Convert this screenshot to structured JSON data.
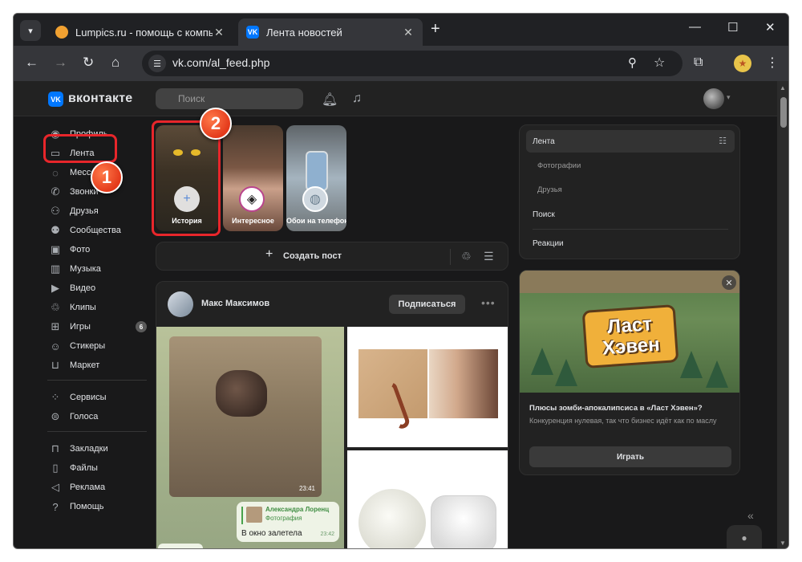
{
  "browser": {
    "tabs": [
      {
        "title": "Lumpics.ru - помощь с компьютером",
        "favicon": "orange-circle-icon"
      },
      {
        "title": "Лента новостей",
        "favicon": "vk-icon"
      }
    ],
    "url": "vk.com/al_feed.php"
  },
  "vk": {
    "logo_text": "вконтакте",
    "logo_mark": "VK",
    "search_placeholder": "Поиск",
    "nav": {
      "group1": [
        "Профиль",
        "Лента",
        "Мессенджер",
        "Звонки",
        "Друзья",
        "Сообщества",
        "Фото",
        "Музыка",
        "Видео",
        "Клипы",
        "Игры",
        "Стикеры",
        "Маркет"
      ],
      "games_badge": "6",
      "group2": [
        "Сервисы",
        "Голоса"
      ],
      "group3": [
        "Закладки",
        "Файлы",
        "Реклама",
        "Помощь"
      ]
    },
    "stories": [
      {
        "label": "История"
      },
      {
        "label": "Интересное"
      },
      {
        "label": "Обои на телефон"
      }
    ],
    "create_post": "Создать пост",
    "post": {
      "author": "Макс Максимов",
      "subscribe": "Подписаться",
      "tg_time1": "23:41",
      "tg_reply_name": "Александра Лоренц",
      "tg_reply_sub": "Фотография",
      "tg_message": "В окно залетела",
      "tg_time2": "23:42"
    },
    "right_menu": {
      "feed": "Лента",
      "photos": "Фотографии",
      "friends": "Друзья",
      "search": "Поиск",
      "reactions": "Реакции"
    },
    "ad": {
      "logo_line1": "Ласт",
      "logo_line2": "Хэвен",
      "title": "Плюсы зомби-апокалипсиса в «Ласт Хэвен»?",
      "description": "Конкуренция нулевая, так что бизнес идёт как по маслу",
      "button": "Играть"
    }
  },
  "annotations": {
    "marker1": "1",
    "marker2": "2",
    "color": "#e8262b"
  },
  "colors": {
    "vk_blue": "#0077ff",
    "bg": "#19191a",
    "card": "#222222",
    "text": "#e1e3e6"
  }
}
